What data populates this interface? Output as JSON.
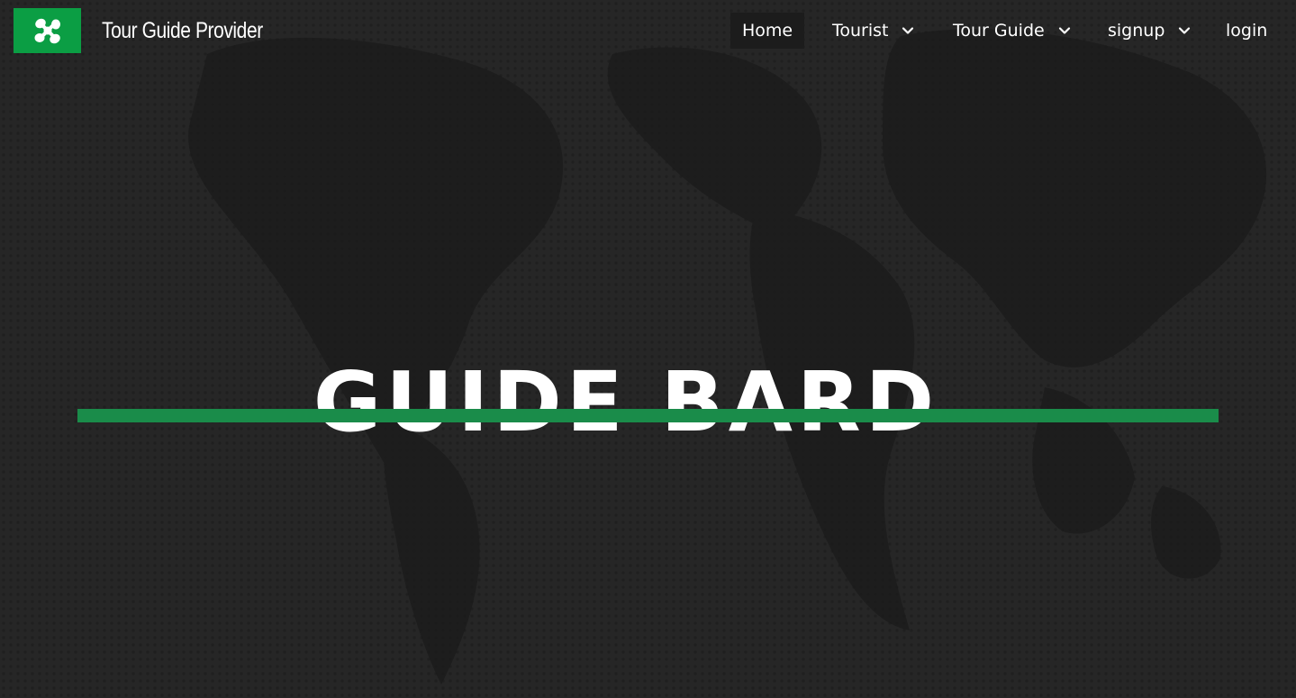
{
  "brand": {
    "name": "Tour Guide Provider",
    "logo_icon": "propeller-icon",
    "logo_bg": "#0b9e44"
  },
  "nav": {
    "home": "Home",
    "tourist": "Tourist",
    "tour_guide": "Tour Guide",
    "signup": "signup",
    "login": "login",
    "dropdown_icon": "chevron-down-icon"
  },
  "hero": {
    "title": "GUIDE BARD",
    "accent_color": "#1a8c4a"
  },
  "colors": {
    "background": "#262626",
    "text": "#ffffff"
  }
}
